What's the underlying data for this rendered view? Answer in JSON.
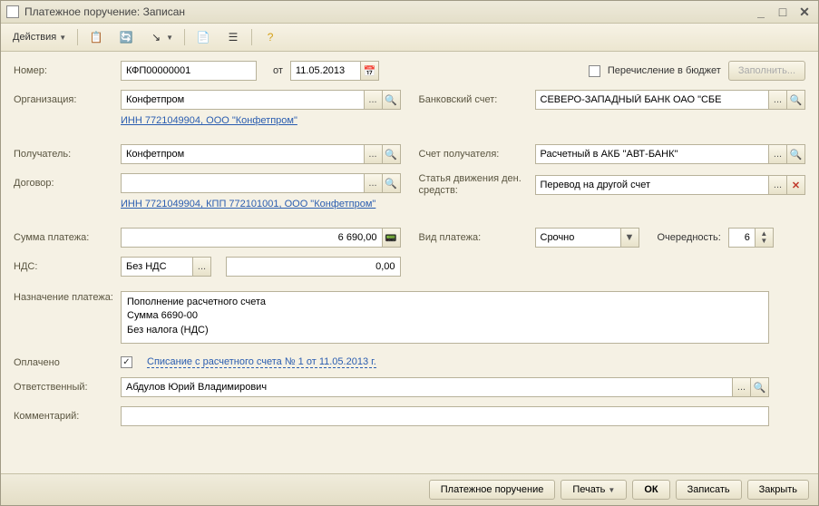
{
  "window": {
    "title": "Платежное поручение: Записан"
  },
  "toolbar": {
    "actions": "Действия"
  },
  "labels": {
    "number": "Номер:",
    "from": "от",
    "budget_transfer": "Перечисление в бюджет",
    "fill": "Заполнить...",
    "organization": "Организация:",
    "bank_account": "Банковский счет:",
    "recipient": "Получатель:",
    "recipient_account": "Счет получателя:",
    "contract": "Договор:",
    "cashflow": "Статья движения ден. средств:",
    "amount": "Сумма платежа:",
    "payment_type": "Вид платежа:",
    "priority": "Очередность:",
    "vat": "НДС:",
    "purpose": "Назначение платежа:",
    "paid": "Оплачено",
    "responsible": "Ответственный:",
    "comment": "Комментарий:"
  },
  "values": {
    "number": "КФП00000001",
    "date": "11.05.2013",
    "organization": "Конфетпром",
    "org_link": "ИНН 7721049904, ООО \"Конфетпром\"",
    "bank_account": "СЕВЕРО-ЗАПАДНЫЙ БАНК ОАО \"СБЕ",
    "recipient": "Конфетпром",
    "recipient_account": "Расчетный в АКБ \"АВТ-БАНК\"",
    "recipient_link": "ИНН 7721049904, КПП 772101001, ООО \"Конфетпром\"",
    "contract": "",
    "cashflow": "Перевод на другой счет",
    "amount": "6 690,00",
    "payment_type": "Срочно",
    "priority": "6",
    "vat_type": "Без НДС",
    "vat_amount": "0,00",
    "purpose": "Пополнение расчетного счета\nСумма 6690-00\nБез налога (НДС)",
    "paid_link": "Списание с расчетного счета № 1 от 11.05.2013 г.",
    "responsible": "Абдулов Юрий Владимирович",
    "comment": ""
  },
  "footer": {
    "main_action": "Платежное поручение",
    "print": "Печать",
    "ok": "ОК",
    "save": "Записать",
    "close": "Закрыть"
  }
}
